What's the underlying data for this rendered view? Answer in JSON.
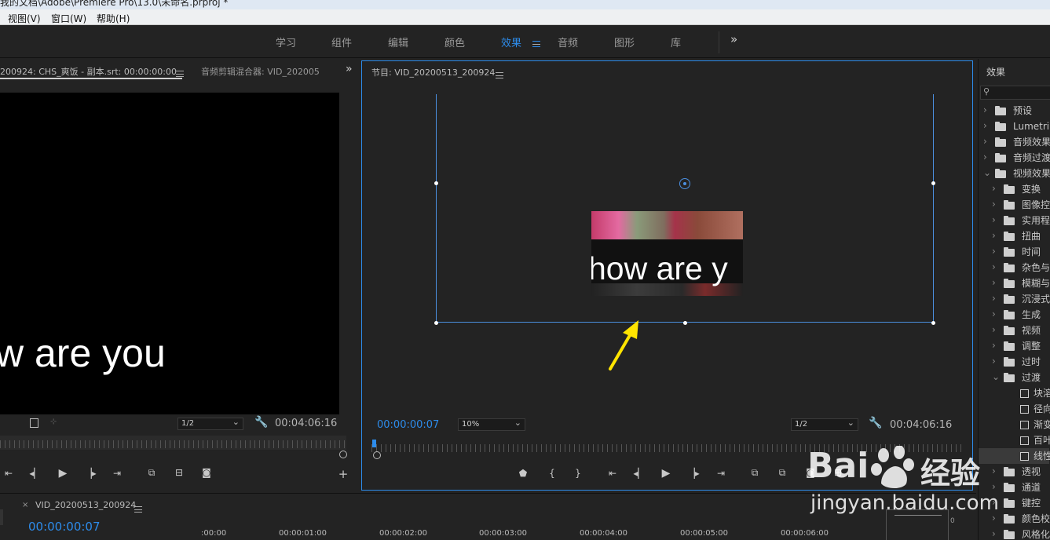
{
  "window": {
    "title": "我的文档\\Adobe\\Premiere Pro\\13.0\\未命名.prproj *"
  },
  "menu": [
    "视图(V)",
    "窗口(W)",
    "帮助(H)"
  ],
  "workspaces": {
    "tabs": [
      "学习",
      "组件",
      "编辑",
      "颜色",
      "效果",
      "音频",
      "图形",
      "库"
    ],
    "active": "效果",
    "more": "»"
  },
  "source_panel": {
    "tab_label": "200924:  CHS_爽饭 - 副本.srt: 00:00:00:00",
    "tab2_label": "音频剪辑混合器: VID_202005",
    "more": "»",
    "caption_text": "w are you",
    "resolution": "1/2",
    "duration": "00:04:06:16"
  },
  "program_panel": {
    "tab_label": "节目: VID_20200513_200924",
    "current_time": "00:00:00:07",
    "zoom": "10%",
    "resolution": "1/2",
    "duration": "00:04:06:16",
    "caption_text": "how are y"
  },
  "effects_panel": {
    "title": "效果",
    "items": [
      {
        "label": "预设",
        "type": "star-folder",
        "indent": 0,
        "expanded": false
      },
      {
        "label": "Lumetri 预",
        "type": "star-folder",
        "indent": 0,
        "expanded": false
      },
      {
        "label": "音频效果",
        "type": "folder",
        "indent": 0,
        "expanded": false
      },
      {
        "label": "音频过渡",
        "type": "folder",
        "indent": 0,
        "expanded": false
      },
      {
        "label": "视频效果",
        "type": "folder",
        "indent": 0,
        "expanded": true
      },
      {
        "label": "变换",
        "type": "folder",
        "indent": 1,
        "expanded": false
      },
      {
        "label": "图像控",
        "type": "folder",
        "indent": 1,
        "expanded": false
      },
      {
        "label": "实用程",
        "type": "folder",
        "indent": 1,
        "expanded": false
      },
      {
        "label": "扭曲",
        "type": "folder",
        "indent": 1,
        "expanded": false
      },
      {
        "label": "时间",
        "type": "folder",
        "indent": 1,
        "expanded": false
      },
      {
        "label": "杂色与",
        "type": "folder",
        "indent": 1,
        "expanded": false
      },
      {
        "label": "模糊与",
        "type": "folder",
        "indent": 1,
        "expanded": false
      },
      {
        "label": "沉浸式",
        "type": "folder",
        "indent": 1,
        "expanded": false
      },
      {
        "label": "生成",
        "type": "folder",
        "indent": 1,
        "expanded": false
      },
      {
        "label": "视频",
        "type": "folder",
        "indent": 1,
        "expanded": false
      },
      {
        "label": "调整",
        "type": "folder",
        "indent": 1,
        "expanded": false
      },
      {
        "label": "过时",
        "type": "folder",
        "indent": 1,
        "expanded": false
      },
      {
        "label": "过渡",
        "type": "folder",
        "indent": 1,
        "expanded": true
      },
      {
        "label": "块溶",
        "type": "effect",
        "indent": 2
      },
      {
        "label": "径向",
        "type": "effect",
        "indent": 2
      },
      {
        "label": "渐变",
        "type": "effect",
        "indent": 2
      },
      {
        "label": "百叶",
        "type": "effect",
        "indent": 2
      },
      {
        "label": "线性",
        "type": "effect",
        "indent": 2,
        "selected": true
      },
      {
        "label": "透视",
        "type": "folder",
        "indent": 1,
        "expanded": false
      },
      {
        "label": "通道",
        "type": "folder",
        "indent": 1,
        "expanded": false
      },
      {
        "label": "键控",
        "type": "folder",
        "indent": 1,
        "expanded": false
      },
      {
        "label": "颜色校",
        "type": "folder",
        "indent": 1,
        "expanded": false
      },
      {
        "label": "风格化",
        "type": "folder",
        "indent": 1,
        "expanded": false
      }
    ]
  },
  "timeline": {
    "tab_label": "VID_20200513_200924",
    "current_time": "00:00:00:07",
    "ruler_labels": [
      ":00:00",
      "00:00:01:00",
      "00:00:02:00",
      "00:00:03:00",
      "00:00:04:00",
      "00:00:05:00",
      "00:00:06:00"
    ],
    "meter_label": "0"
  },
  "watermark": {
    "brand": "Bai",
    "brand2": "经验",
    "url": "jingyan.baidu.com"
  },
  "colors": {
    "accent": "#2d8ceb",
    "arrow": "#ffe400",
    "panel_bg": "#232323",
    "selection": "#2d8ceb"
  }
}
